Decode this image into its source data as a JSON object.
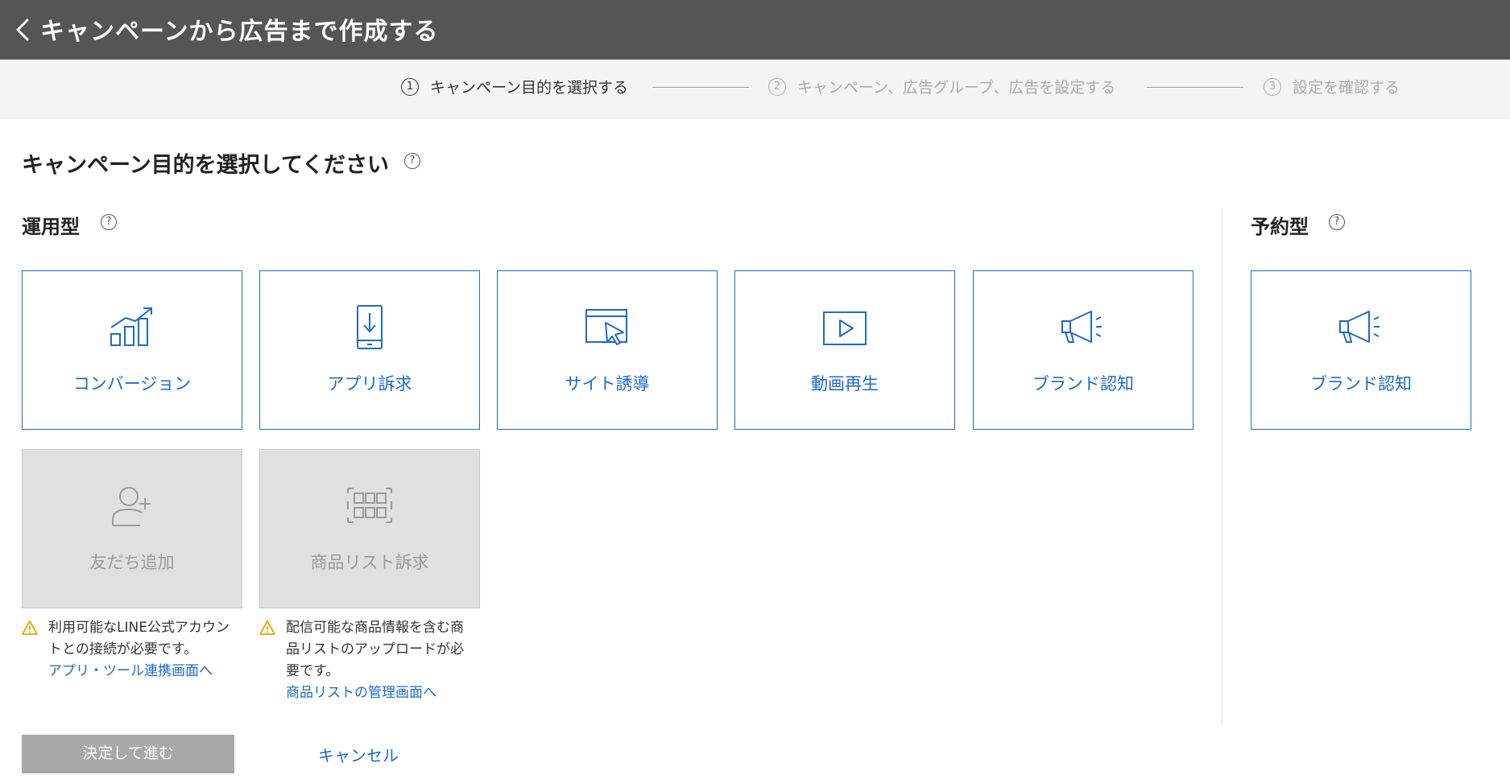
{
  "header": {
    "title": "キャンペーンから広告まで作成する"
  },
  "steps": [
    {
      "num": "1",
      "label": "キャンペーン目的を選択する",
      "active": true
    },
    {
      "num": "2",
      "label": "キャンペーン、広告グループ、広告を設定する",
      "active": false
    },
    {
      "num": "3",
      "label": "設定を確認する",
      "active": false
    }
  ],
  "main": {
    "heading": "キャンペーン目的を選択してください",
    "help_glyph": "?",
    "operational": {
      "label": "運用型",
      "cards": [
        {
          "label": "コンバージョン",
          "icon": "chart-icon"
        },
        {
          "label": "アプリ訴求",
          "icon": "app-download-icon"
        },
        {
          "label": "サイト誘導",
          "icon": "browser-cursor-icon"
        },
        {
          "label": "動画再生",
          "icon": "video-play-icon"
        },
        {
          "label": "ブランド認知",
          "icon": "megaphone-icon"
        }
      ],
      "disabled_cards": [
        {
          "label": "友だち追加",
          "icon": "add-friend-icon",
          "note": "利用可能なLINE公式アカウントとの接続が必要です。",
          "link": "アプリ・ツール連携画面へ"
        },
        {
          "label": "商品リスト訴求",
          "icon": "product-list-icon",
          "note": "配信可能な商品情報を含む商品リストのアップロードが必要です。",
          "link": "商品リストの管理画面へ"
        }
      ]
    },
    "reserved": {
      "label": "予約型",
      "cards": [
        {
          "label": "ブランド認知",
          "icon": "megaphone-icon"
        }
      ]
    }
  },
  "footer": {
    "submit_label": "決定して進む",
    "cancel_label": "キャンセル"
  },
  "colors": {
    "accent": "#1e6bc9",
    "header_bg": "#555555",
    "disabled_bg": "#e0e0e0",
    "warning": "#e8a600"
  }
}
